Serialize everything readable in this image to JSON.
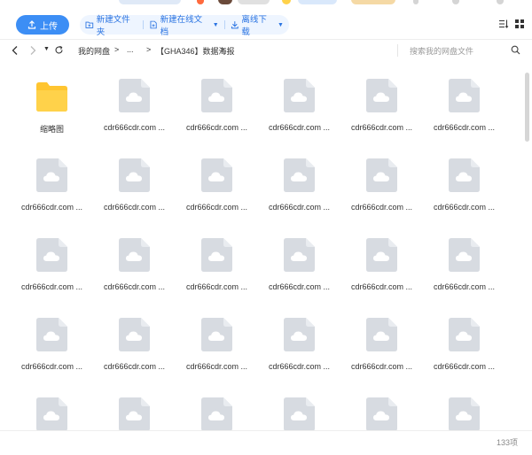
{
  "toolbar": {
    "upload_label": "上传",
    "new_folder_label": "新建文件夹",
    "new_online_doc_label": "新建在线文档",
    "offline_download_label": "离线下载"
  },
  "nav": {
    "breadcrumb": [
      "我的网盘",
      ">",
      "...",
      ">",
      "【GHA346】数据海报",
      ">"
    ],
    "search_placeholder": "搜索我的网盘文件"
  },
  "files": [
    {
      "label": "缩略图",
      "type": "folder"
    },
    {
      "label": "cdr666cdr.com ...",
      "type": "file"
    },
    {
      "label": "cdr666cdr.com ...",
      "type": "file"
    },
    {
      "label": "cdr666cdr.com ...",
      "type": "file"
    },
    {
      "label": "cdr666cdr.com ...",
      "type": "file"
    },
    {
      "label": "cdr666cdr.com ...",
      "type": "file"
    },
    {
      "label": "cdr666cdr.com ...",
      "type": "file"
    },
    {
      "label": "cdr666cdr.com ...",
      "type": "file"
    },
    {
      "label": "cdr666cdr.com ...",
      "type": "file"
    },
    {
      "label": "cdr666cdr.com ...",
      "type": "file"
    },
    {
      "label": "cdr666cdr.com ...",
      "type": "file"
    },
    {
      "label": "cdr666cdr.com ...",
      "type": "file"
    },
    {
      "label": "cdr666cdr.com ...",
      "type": "file"
    },
    {
      "label": "cdr666cdr.com ...",
      "type": "file"
    },
    {
      "label": "cdr666cdr.com ...",
      "type": "file"
    },
    {
      "label": "cdr666cdr.com ...",
      "type": "file"
    },
    {
      "label": "cdr666cdr.com ...",
      "type": "file"
    },
    {
      "label": "cdr666cdr.com ...",
      "type": "file"
    },
    {
      "label": "cdr666cdr.com ...",
      "type": "file"
    },
    {
      "label": "cdr666cdr.com ...",
      "type": "file"
    },
    {
      "label": "cdr666cdr.com ...",
      "type": "file"
    },
    {
      "label": "cdr666cdr.com ...",
      "type": "file"
    },
    {
      "label": "cdr666cdr.com ...",
      "type": "file"
    },
    {
      "label": "cdr666cdr.com ...",
      "type": "file"
    },
    {
      "label": "",
      "type": "file"
    },
    {
      "label": "",
      "type": "file"
    },
    {
      "label": "",
      "type": "file"
    },
    {
      "label": "",
      "type": "file"
    },
    {
      "label": "",
      "type": "file"
    },
    {
      "label": "",
      "type": "file"
    }
  ],
  "footer": {
    "count": "133项"
  },
  "colors": {
    "accent": "#3c8ef5",
    "folder": "#ffc530",
    "file_thumb": "#d7dbe1"
  },
  "icons": {
    "upload": "upload-icon",
    "new_folder": "folder-plus-icon",
    "new_doc": "doc-plus-icon",
    "download": "download-icon",
    "sort": "sort-icon",
    "view": "grid-view-icon",
    "search": "search-icon",
    "refresh": "refresh-icon",
    "file": "cloud-file-icon",
    "folder": "folder-icon"
  }
}
